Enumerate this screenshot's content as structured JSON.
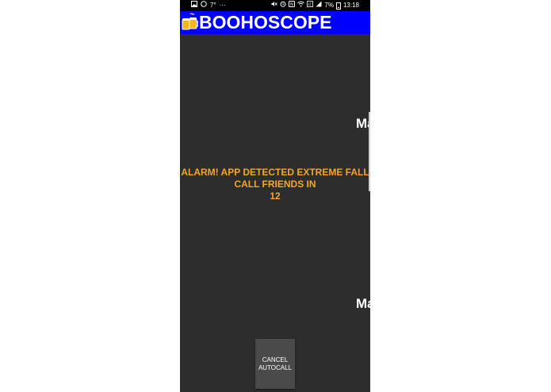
{
  "status_bar": {
    "left_icons": [
      "gallery-icon",
      "whatsapp-icon"
    ],
    "temperature": "7°",
    "more": "···",
    "battery_percent": "7%",
    "time": "13:18"
  },
  "app_bar": {
    "title": "BOOHOSCOPE",
    "background": "#0000ff"
  },
  "side_labels": {
    "top": "Ma",
    "bottom": "Ma"
  },
  "alarm": {
    "line1": "ALARM! APP DETECTED EXTREME FALL",
    "line2": "CALL FRIENDS IN",
    "countdown": "12",
    "color": "#f5a623"
  },
  "cancel_button": {
    "line1": "CANCEL",
    "line2": "AUTOCALL"
  }
}
